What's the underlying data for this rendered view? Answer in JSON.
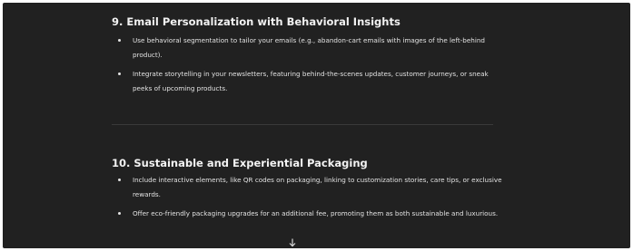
{
  "sections": [
    {
      "heading": "9. Email Personalization with Behavioral Insights",
      "bullets": [
        "Use behavioral segmentation to tailor your emails (e.g., abandon-cart emails with images of the left-behind product).",
        "Integrate storytelling in your newsletters, featuring behind-the-scenes updates, customer journeys, or sneak peeks of upcoming products."
      ]
    },
    {
      "heading": "10. Sustainable and Experiential Packaging",
      "bullets": [
        "Include interactive elements, like QR codes on packaging, linking to customization stories, care tips, or exclusive rewards.",
        "Offer eco-friendly packaging upgrades for an additional fee, promoting them as both sustainable and luxurious."
      ]
    }
  ],
  "scroll_button": {
    "icon": "arrow-down-icon"
  }
}
